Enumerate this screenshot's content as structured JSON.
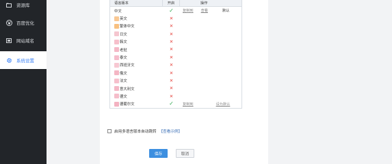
{
  "sidebar": {
    "items": [
      {
        "label": "资源库",
        "icon": "folder-icon"
      },
      {
        "label": "百度优化",
        "icon": "paw-icon"
      },
      {
        "label": "网站域名",
        "icon": "domain-icon"
      },
      {
        "label": "系统设置",
        "icon": "gear-icon"
      }
    ]
  },
  "table": {
    "headers": {
      "lang": "语言版本",
      "open": "开启",
      "ops": "操作"
    },
    "rows": [
      {
        "lang": "中文",
        "enabled": true,
        "ops": [
          "复制到",
          "查看"
        ],
        "default": "默认"
      },
      {
        "lang": "英文",
        "enabled": false
      },
      {
        "lang": "繁体中文",
        "enabled": false
      },
      {
        "lang": "日文",
        "enabled": false
      },
      {
        "lang": "韩文",
        "enabled": false
      },
      {
        "lang": "老挝",
        "enabled": false
      },
      {
        "lang": "泰文",
        "enabled": false
      },
      {
        "lang": "西班牙文",
        "enabled": false
      },
      {
        "lang": "俄文",
        "enabled": false
      },
      {
        "lang": "法文",
        "enabled": false
      },
      {
        "lang": "意大利文",
        "enabled": false
      },
      {
        "lang": "德文",
        "enabled": false
      },
      {
        "lang": "德葡尔文",
        "enabled": true,
        "ops": [
          "复制到"
        ],
        "default": "设为默认"
      }
    ]
  },
  "options": {
    "auto_redirect": "启用多语言版本自动跳转",
    "example_link": "【查看示例】"
  },
  "buttons": {
    "save": "保存",
    "cancel": "取消"
  },
  "colors": {
    "accent": "#3b82f6",
    "ok": "#2fa84f",
    "no": "#e5413b",
    "flag": "#f5b7c4"
  }
}
